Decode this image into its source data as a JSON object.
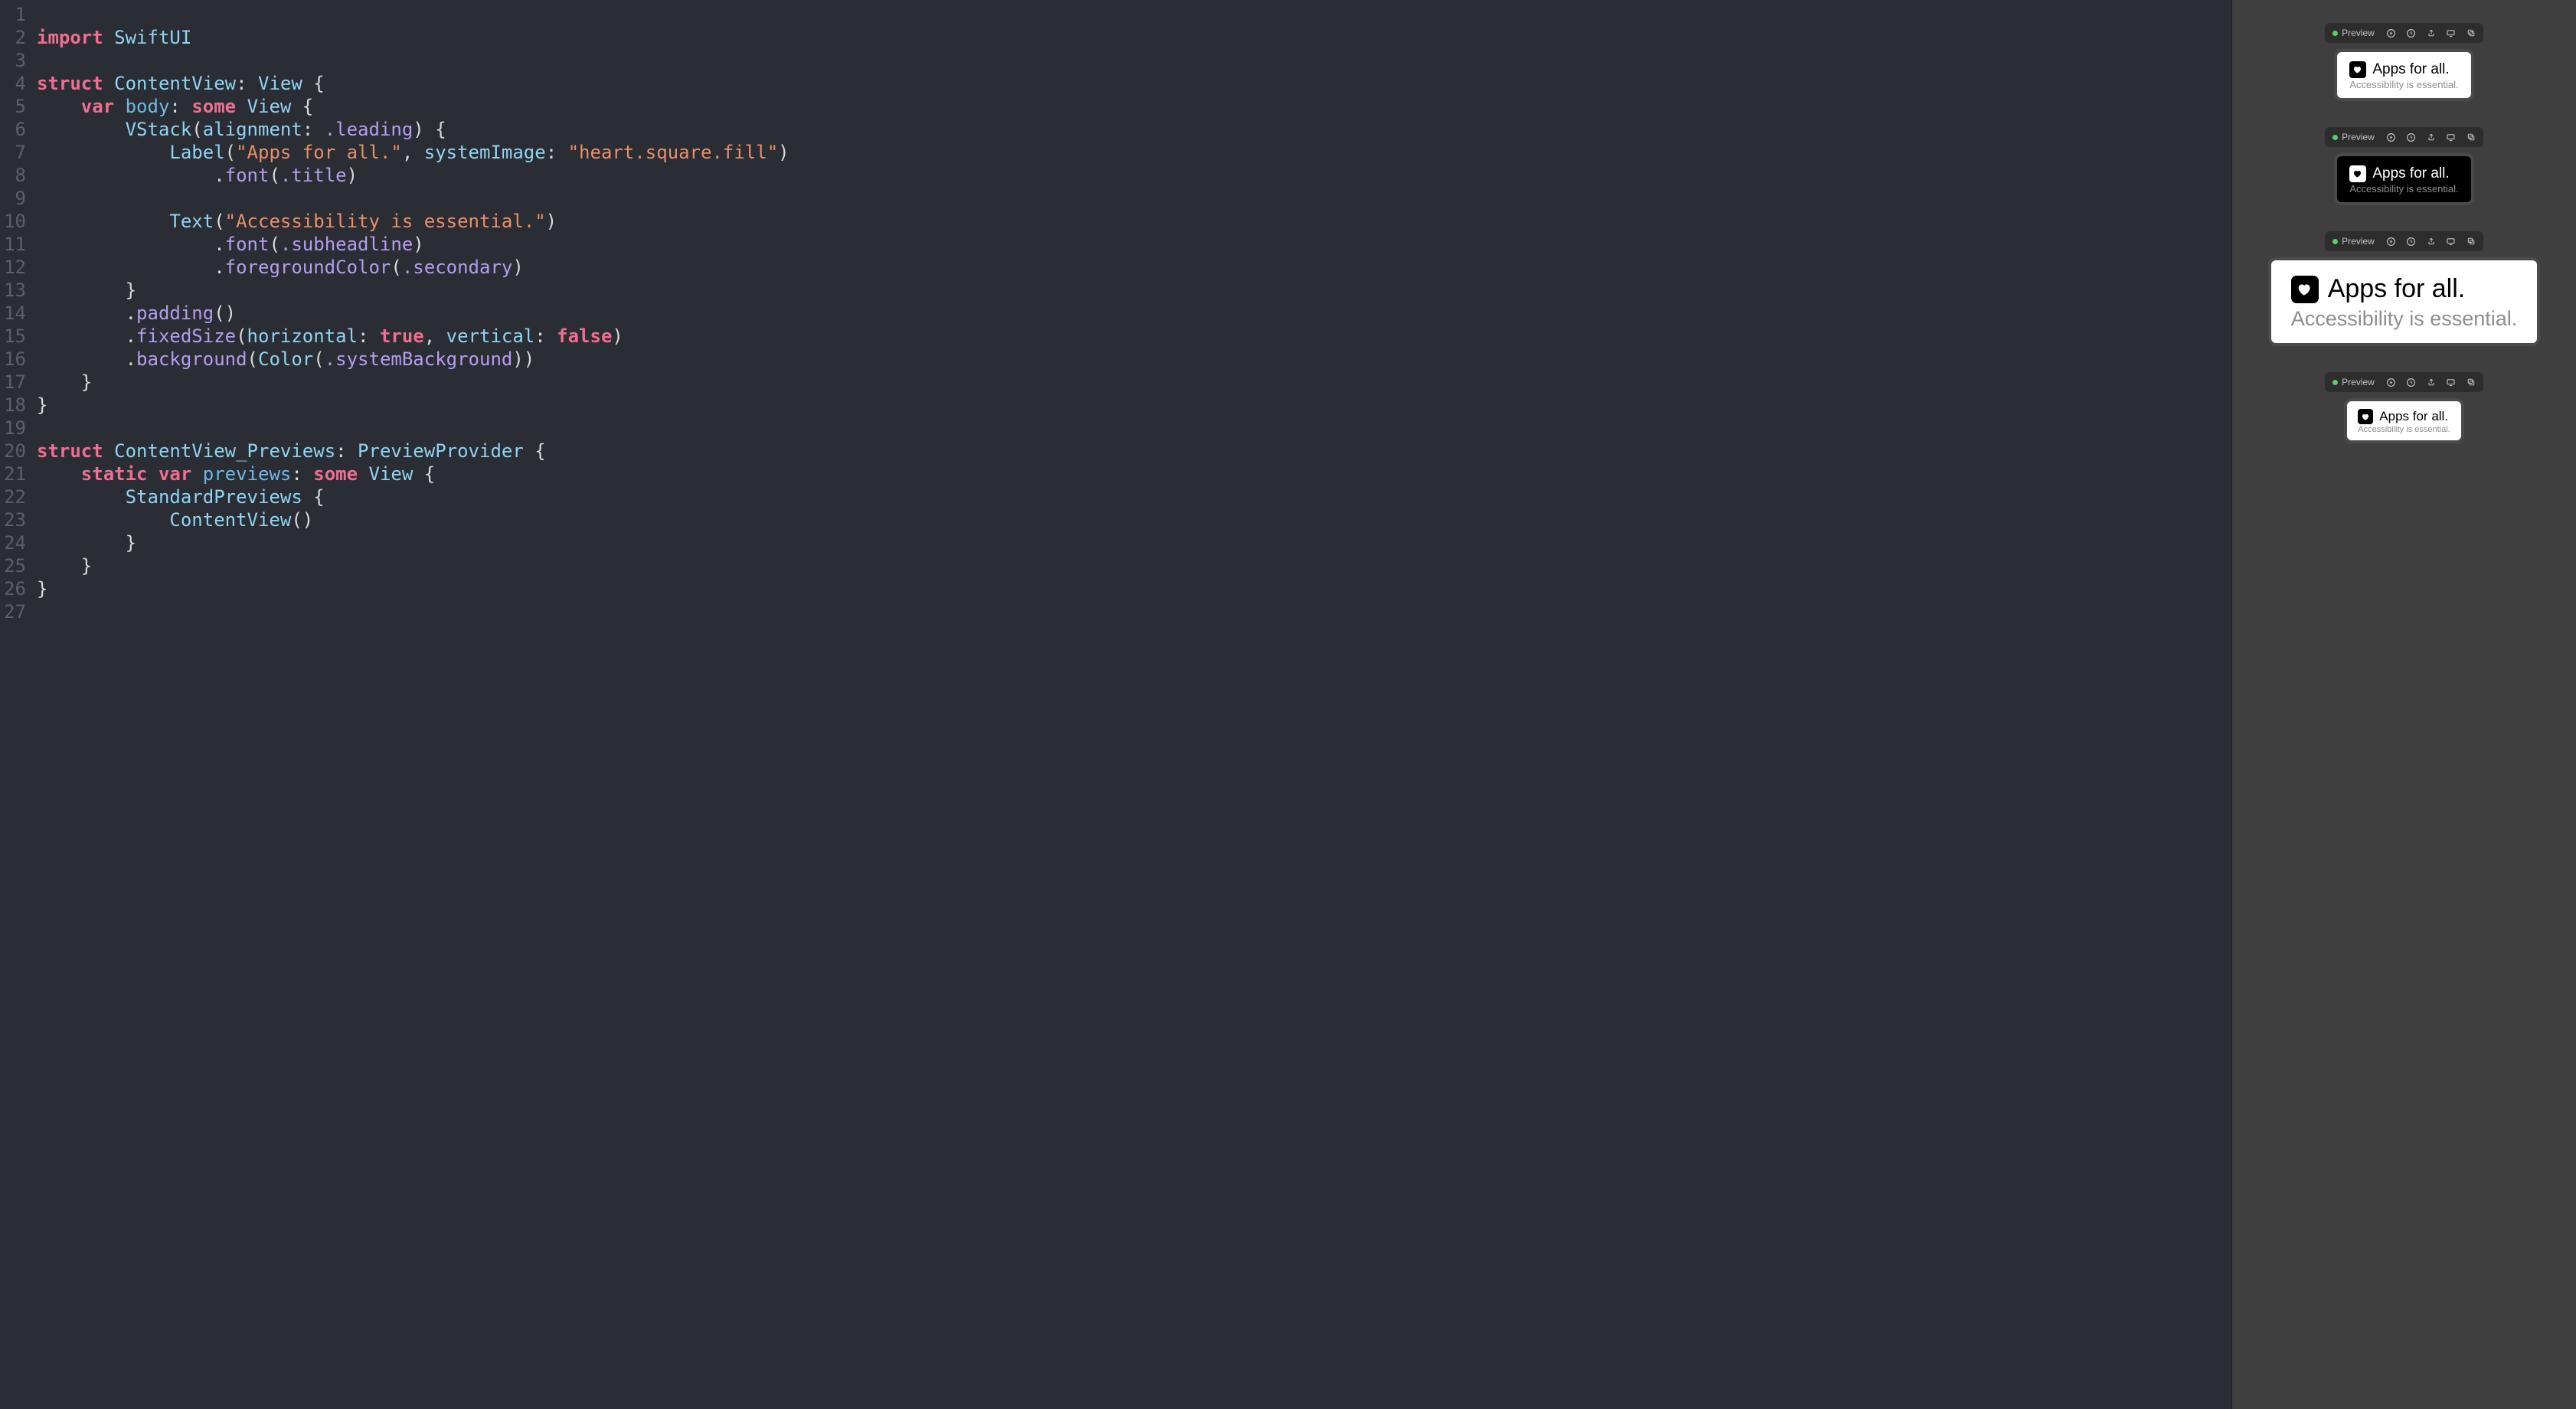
{
  "toolbar_label": "Preview",
  "code": {
    "lines": [
      [],
      [
        [
          "key",
          "import"
        ],
        [
          "plain",
          " "
        ],
        [
          "type",
          "SwiftUI"
        ]
      ],
      [],
      [
        [
          "key",
          "struct"
        ],
        [
          "plain",
          " "
        ],
        [
          "type",
          "ContentView"
        ],
        [
          "pun",
          ": "
        ],
        [
          "type",
          "View"
        ],
        [
          "pun",
          " {"
        ]
      ],
      [
        [
          "plain",
          "    "
        ],
        [
          "key",
          "var"
        ],
        [
          "plain",
          " "
        ],
        [
          "prop",
          "body"
        ],
        [
          "pun",
          ": "
        ],
        [
          "key",
          "some"
        ],
        [
          "plain",
          " "
        ],
        [
          "type",
          "View"
        ],
        [
          "pun",
          " {"
        ]
      ],
      [
        [
          "plain",
          "        "
        ],
        [
          "type",
          "VStack"
        ],
        [
          "pun",
          "("
        ],
        [
          "param",
          "alignment"
        ],
        [
          "pun",
          ": "
        ],
        [
          "enum",
          ".leading"
        ],
        [
          "pun",
          ") {"
        ]
      ],
      [
        [
          "plain",
          "            "
        ],
        [
          "type",
          "Label"
        ],
        [
          "pun",
          "("
        ],
        [
          "str",
          "\"Apps for all.\""
        ],
        [
          "pun",
          ", "
        ],
        [
          "param",
          "systemImage"
        ],
        [
          "pun",
          ": "
        ],
        [
          "str",
          "\"heart.square.fill\""
        ],
        [
          "pun",
          ")"
        ]
      ],
      [
        [
          "plain",
          "                "
        ],
        [
          "pun",
          "."
        ],
        [
          "func",
          "font"
        ],
        [
          "pun",
          "("
        ],
        [
          "enum",
          ".title"
        ],
        [
          "pun",
          ")"
        ]
      ],
      [],
      [
        [
          "plain",
          "            "
        ],
        [
          "type",
          "Text"
        ],
        [
          "pun",
          "("
        ],
        [
          "str",
          "\"Accessibility is essential.\""
        ],
        [
          "pun",
          ")"
        ]
      ],
      [
        [
          "plain",
          "                "
        ],
        [
          "pun",
          "."
        ],
        [
          "func",
          "font"
        ],
        [
          "pun",
          "("
        ],
        [
          "enum",
          ".subheadline"
        ],
        [
          "pun",
          ")"
        ]
      ],
      [
        [
          "plain",
          "                "
        ],
        [
          "pun",
          "."
        ],
        [
          "func",
          "foregroundColor"
        ],
        [
          "pun",
          "("
        ],
        [
          "enum",
          ".secondary"
        ],
        [
          "pun",
          ")"
        ]
      ],
      [
        [
          "plain",
          "        "
        ],
        [
          "pun",
          "}"
        ]
      ],
      [
        [
          "plain",
          "        "
        ],
        [
          "pun",
          "."
        ],
        [
          "func",
          "padding"
        ],
        [
          "pun",
          "()"
        ]
      ],
      [
        [
          "plain",
          "        "
        ],
        [
          "pun",
          "."
        ],
        [
          "func",
          "fixedSize"
        ],
        [
          "pun",
          "("
        ],
        [
          "param",
          "horizontal"
        ],
        [
          "pun",
          ": "
        ],
        [
          "key",
          "true"
        ],
        [
          "pun",
          ", "
        ],
        [
          "param",
          "vertical"
        ],
        [
          "pun",
          ": "
        ],
        [
          "key",
          "false"
        ],
        [
          "pun",
          ")"
        ]
      ],
      [
        [
          "plain",
          "        "
        ],
        [
          "pun",
          "."
        ],
        [
          "func",
          "background"
        ],
        [
          "pun",
          "("
        ],
        [
          "type",
          "Color"
        ],
        [
          "pun",
          "("
        ],
        [
          "enum",
          ".systemBackground"
        ],
        [
          "pun",
          "))"
        ]
      ],
      [
        [
          "plain",
          "    "
        ],
        [
          "pun",
          "}"
        ]
      ],
      [
        [
          "pun",
          "}"
        ]
      ],
      [],
      [
        [
          "key",
          "struct"
        ],
        [
          "plain",
          " "
        ],
        [
          "type",
          "ContentView_Previews"
        ],
        [
          "pun",
          ": "
        ],
        [
          "type",
          "PreviewProvider"
        ],
        [
          "pun",
          " {"
        ]
      ],
      [
        [
          "plain",
          "    "
        ],
        [
          "key",
          "static"
        ],
        [
          "plain",
          " "
        ],
        [
          "key",
          "var"
        ],
        [
          "plain",
          " "
        ],
        [
          "prop",
          "previews"
        ],
        [
          "pun",
          ": "
        ],
        [
          "key",
          "some"
        ],
        [
          "plain",
          " "
        ],
        [
          "type",
          "View"
        ],
        [
          "pun",
          " {"
        ]
      ],
      [
        [
          "plain",
          "        "
        ],
        [
          "type",
          "StandardPreviews"
        ],
        [
          "pun",
          " {"
        ]
      ],
      [
        [
          "plain",
          "            "
        ],
        [
          "type",
          "ContentView"
        ],
        [
          "pun",
          "()"
        ]
      ],
      [
        [
          "plain",
          "        "
        ],
        [
          "pun",
          "}"
        ]
      ],
      [
        [
          "plain",
          "    "
        ],
        [
          "pun",
          "}"
        ]
      ],
      [
        [
          "pun",
          "}"
        ]
      ],
      []
    ]
  },
  "previews": [
    {
      "theme": "light",
      "size": "normal",
      "title": "Apps for all.",
      "subtitle": "Accessibility is essential."
    },
    {
      "theme": "dark",
      "size": "normal",
      "title": "Apps for all.",
      "subtitle": "Accessibility is essential."
    },
    {
      "theme": "light",
      "size": "large",
      "title": "Apps for all.",
      "subtitle": "Accessibility is essential."
    },
    {
      "theme": "light",
      "size": "small",
      "title": "Apps for all.",
      "subtitle": "Accessibility is essential."
    }
  ]
}
